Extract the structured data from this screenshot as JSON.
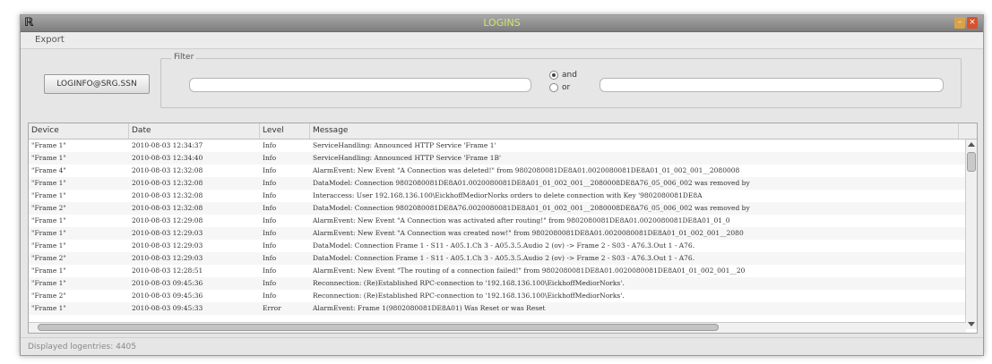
{
  "window": {
    "title": "LOGINS",
    "app_icon": "app-logo-icon",
    "minimize_glyph": "–",
    "close_glyph": "×"
  },
  "menu": {
    "export_label": "Export"
  },
  "login": {
    "button_label": "LOGINFO@SRG.SSN"
  },
  "filter": {
    "legend": "Filter",
    "input1_value": "",
    "input2_value": "",
    "radio_and_label": "and",
    "radio_or_label": "or",
    "selected": "and"
  },
  "table": {
    "columns": [
      "Device",
      "Date",
      "Level",
      "Message"
    ],
    "rows": [
      [
        "\"Frame 1\"",
        "2010-08-03 12:34:37",
        "Info",
        "ServiceHandling: Announced HTTP Service 'Frame 1'"
      ],
      [
        "\"Frame 1\"",
        "2010-08-03 12:34:40",
        "Info",
        "ServiceHandling: Announced HTTP Service 'Frame 1B'"
      ],
      [
        "\"Frame 4\"",
        "2010-08-03 12:32:08",
        "Info",
        "AlarmEvent: New Event \"A Connection was deleted!\" from 9802080081DE8A01.0020080081DE8A01_01_002_001__2080008"
      ],
      [
        "\"Frame 1\"",
        "2010-08-03 12:32:08",
        "Info",
        "DataModel: Connection 9802080081DE8A01.0020080081DE8A01_01_002_001__2080008DE8A76_05_006_002 was removed by"
      ],
      [
        "\"Frame 1\"",
        "2010-08-03 12:32:08",
        "Info",
        "Interaccess: User 192.168.136.100\\EickhoffMediorNorks orders to delete connection with Key '9802080081DE8A"
      ],
      [
        "\"Frame 2\"",
        "2010-08-03 12:32:08",
        "Info",
        "DataModel: Connection 9802080081DE8A76.0020080081DE8A01_01_002_001__2080008DE8A76_05_006_002 was removed by"
      ],
      [
        "\"Frame 1\"",
        "2010-08-03 12:29:08",
        "Info",
        "AlarmEvent: New Event \"A Connection was activated after routing!\" from 9802080081DE8A01.0020080081DE8A01_01_0"
      ],
      [
        "\"Frame 1\"",
        "2010-08-03 12:29:03",
        "Info",
        "AlarmEvent: New Event \"A Connection was created now!\" from 9802080081DE8A01.0020080081DE8A01_01_002_001__2080"
      ],
      [
        "\"Frame 1\"",
        "2010-08-03 12:29:03",
        "Info",
        "DataModel: Connection Frame 1 - S11 - A05.1.Ch 3 - A05.3.5.Audio 2 (ov) -> Frame 2 - S03 - A76.3.Out 1 - A76."
      ],
      [
        "\"Frame 2\"",
        "2010-08-03 12:29:03",
        "Info",
        "DataModel: Connection Frame 1 - S11 - A05.1.Ch 3 - A05.3.5.Audio 2 (ov) -> Frame 2 - S03 - A76.3.Out 1 - A76."
      ],
      [
        "\"Frame 1\"",
        "2010-08-03 12:28:51",
        "Info",
        "AlarmEvent: New Event \"The routing of a connection failed!\" from 9802080081DE8A01.0020080081DE8A01_01_002_001__20"
      ],
      [
        "\"Frame 1\"",
        "2010-08-03 09:45:36",
        "Info",
        "Reconnection: (Re)Established RPC-connection to '192.168.136.100\\EickhoffMediorNorks'."
      ],
      [
        "\"Frame 2\"",
        "2010-08-03 09:45:36",
        "Info",
        "Reconnection: (Re)Established RPC-connection to '192.168.136.100\\EickhoffMediorNorks'."
      ],
      [
        "\"Frame 1\"",
        "2010-08-03 09:45:33",
        "Error",
        "AlarmEvent: Frame 1(9802080081DE8A01) Was Reset or was Reset"
      ]
    ]
  },
  "status": {
    "text": "Displayed logentries: 4405"
  }
}
